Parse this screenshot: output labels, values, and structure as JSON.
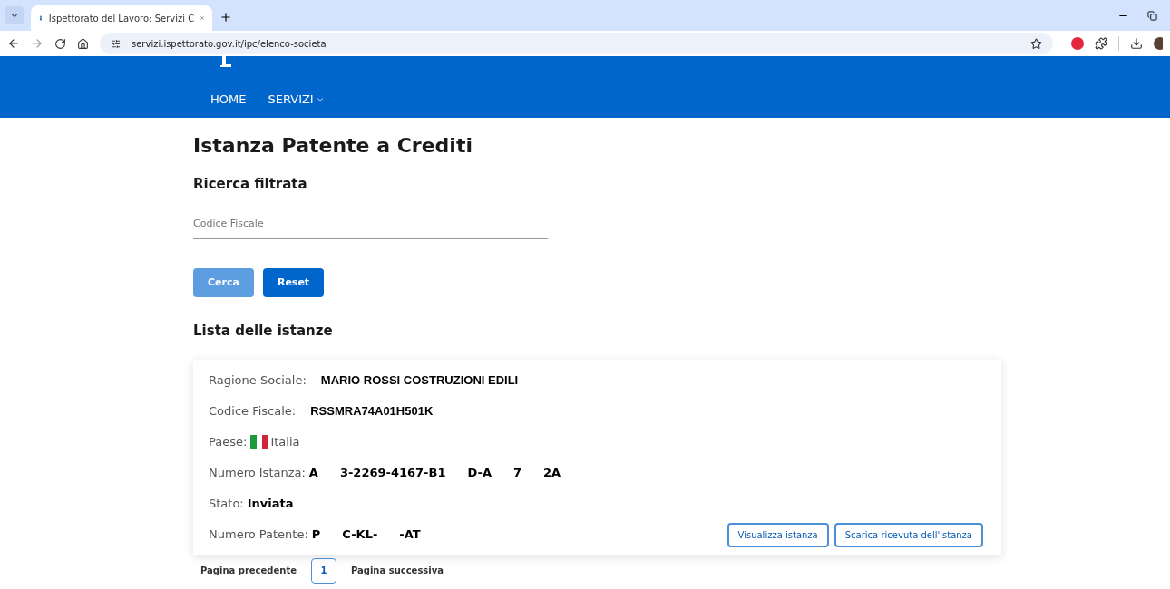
{
  "browser": {
    "tab_title": "Ispettorato del Lavoro: Servizi C",
    "url": "servizi.ispettorato.gov.it/ipc/elenco-societa"
  },
  "nav": {
    "items": [
      {
        "label": "HOME",
        "has_menu": false
      },
      {
        "label": "SERVIZI",
        "has_menu": true
      }
    ]
  },
  "page_title": "Istanza Patente a Crediti",
  "filter": {
    "heading": "Ricerca filtrata",
    "field": {
      "placeholder": "Codice Fiscale"
    },
    "buttons": [
      {
        "label": "Cerca",
        "disabled": true
      },
      {
        "label": "Reset",
        "disabled": false
      }
    ]
  },
  "list": {
    "heading": "Lista delle istanze",
    "items": [
      {
        "fields": [
          {
            "label": "Ragione Sociale:",
            "kind": "plain",
            "value": [
              "MARIO ROSSI COSTRUZIONI EDILI"
            ]
          },
          {
            "label": "Codice Fiscale:",
            "kind": "plain",
            "value": [
              "RSSMRA74A01H501K"
            ]
          },
          {
            "label": "Paese:",
            "kind": "country",
            "value": [
              "Italia"
            ]
          },
          {
            "label": "Numero Istanza:",
            "kind": "redacted",
            "value": [
              "A",
              "3-2269-4167-B1",
              "D-A",
              "7",
              "2A"
            ]
          },
          {
            "label": "Stato:",
            "kind": "bold",
            "value": [
              "Inviata"
            ]
          },
          {
            "label": "Numero Patente:",
            "kind": "redacted",
            "value": [
              "P",
              "C-KL-",
              "-AT"
            ]
          }
        ],
        "actions": [
          "Visualizza istanza",
          "Scarica ricevuta dell'istanza"
        ]
      }
    ]
  },
  "pagination": {
    "previous": "Pagina precedente",
    "pages": [
      {
        "label": "1",
        "selected": true
      }
    ],
    "next": "Pagina successiva"
  }
}
